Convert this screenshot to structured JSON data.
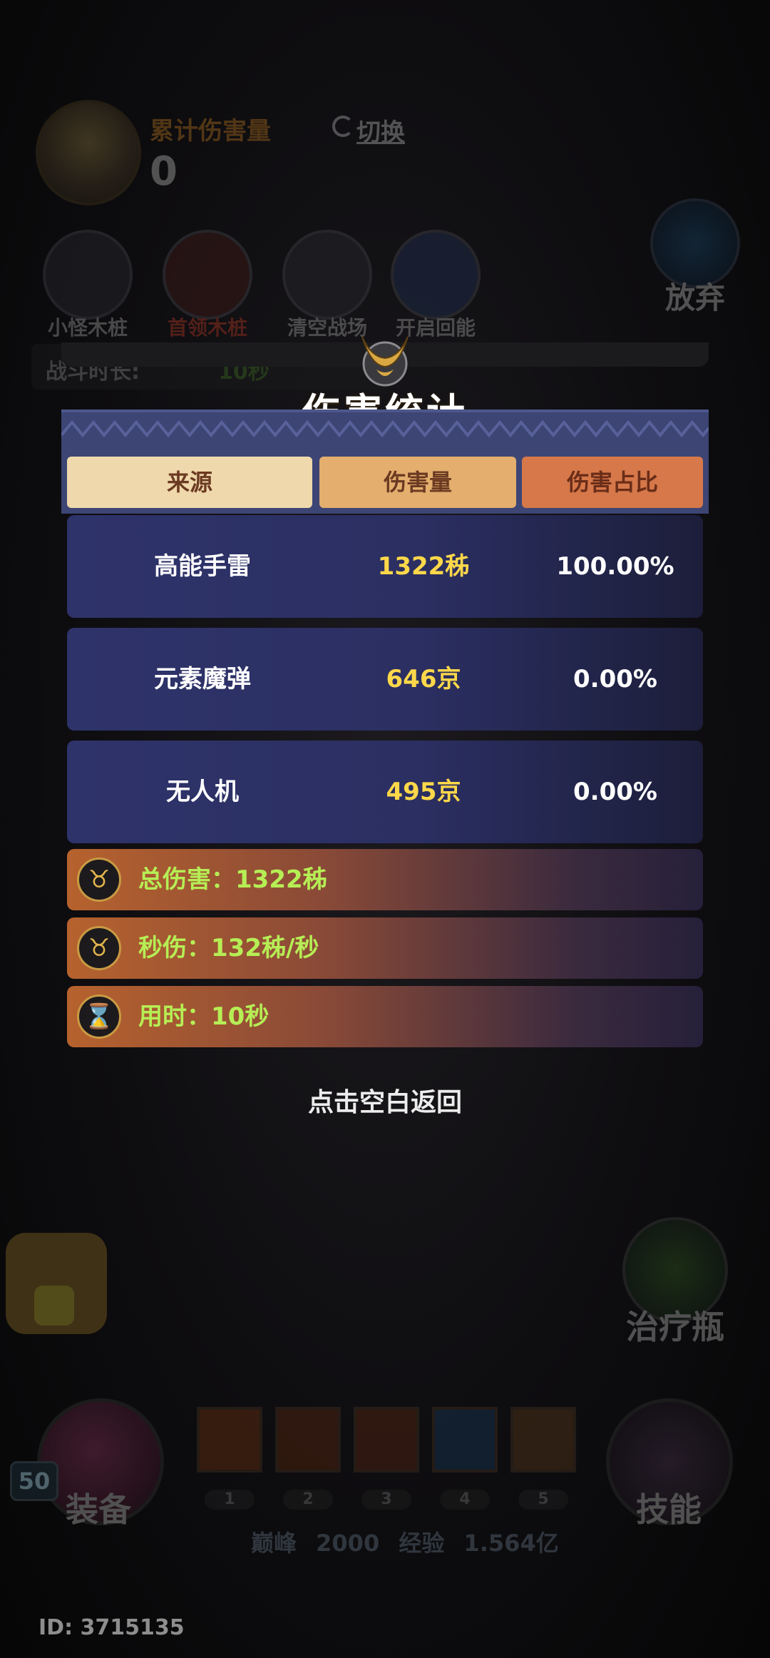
{
  "background": {
    "damage_panel": {
      "title": "累计伤害量",
      "value": "0",
      "switch_label": "切换"
    },
    "quick_actions": [
      {
        "label": "小怪木桩"
      },
      {
        "label": "首领木桩"
      },
      {
        "label": "清空战场"
      },
      {
        "label": "开启回能"
      }
    ],
    "give_up_label": "放弃",
    "battle_time": {
      "label": "战斗时长:",
      "value": "10秒"
    },
    "heal_label": "治疗瓶",
    "equip_label": "装备",
    "skill_label": "技能",
    "level": "50",
    "skill_slots": [
      "1",
      "2",
      "3",
      "4",
      "5"
    ],
    "exp_text": "巅峰 2000 经验 1.564亿",
    "user_id": "ID: 3715135"
  },
  "modal": {
    "title": "伤害统计",
    "columns": {
      "source": "来源",
      "damage": "伤害量",
      "ratio": "伤害占比"
    },
    "rows": [
      {
        "source": "高能手雷",
        "damage": "1322秭",
        "ratio": "100.00%"
      },
      {
        "source": "元素魔弹",
        "damage": "646京",
        "ratio": "0.00%"
      },
      {
        "source": "无人机",
        "damage": "495京",
        "ratio": "0.00%"
      }
    ],
    "stats": [
      {
        "text": "总伤害：1322秭",
        "icon": "horn-emblem-icon"
      },
      {
        "text": "秒伤：132秭/秒",
        "icon": "horn-emblem-icon"
      },
      {
        "text": "用时：10秒",
        "icon": "hourglass-icon"
      }
    ],
    "back_hint": "点击空白返回"
  },
  "colors": {
    "damage_value": "#ffd84a",
    "stat_text": "#b6ee55",
    "header_source": "#efd9ac",
    "header_damage": "#e4ae6e",
    "header_ratio": "#d6784a",
    "row_bg": "#2e336a"
  }
}
